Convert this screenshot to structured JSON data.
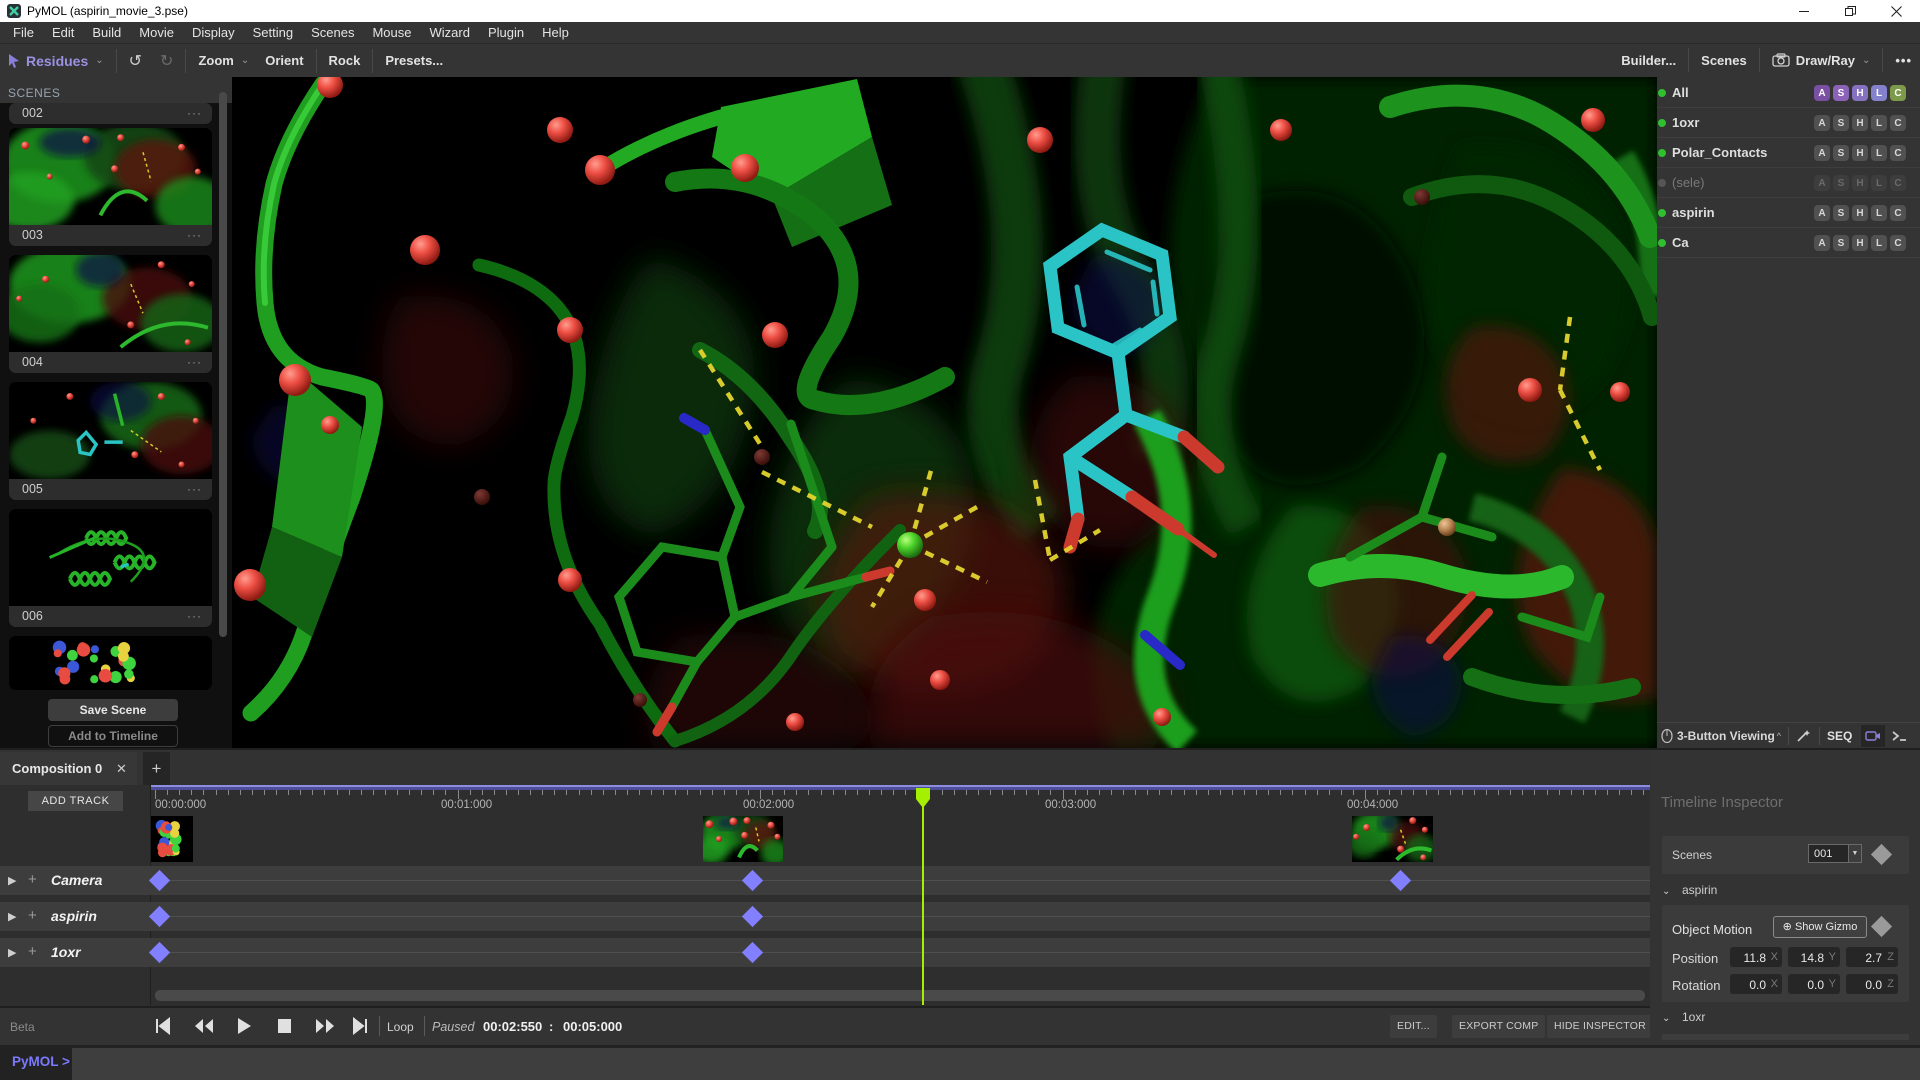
{
  "window": {
    "title": "PyMOL (aspirin_movie_3.pse)"
  },
  "menu": [
    "File",
    "Edit",
    "Build",
    "Movie",
    "Display",
    "Setting",
    "Scenes",
    "Mouse",
    "Wizard",
    "Plugin",
    "Help"
  ],
  "toolbar": {
    "mode": "Residues",
    "undo": "↺",
    "redo": "↻",
    "zoom": "Zoom",
    "orient": "Orient",
    "rock": "Rock",
    "presets": "Presets...",
    "builder": "Builder...",
    "scenes": "Scenes",
    "drawray": "Draw/Ray",
    "more": "•••"
  },
  "scenes_panel": {
    "header": "SCENES",
    "items": [
      {
        "label": "002",
        "more": "···",
        "art": "none"
      },
      {
        "label": "003",
        "more": "···",
        "art": "surf1"
      },
      {
        "label": "004",
        "more": "···",
        "art": "surf2"
      },
      {
        "label": "005",
        "more": "···",
        "art": "cyan"
      },
      {
        "label": "006",
        "more": "···",
        "art": "cartoon"
      }
    ],
    "partial_art": "cpk",
    "save_button": "Save Scene",
    "add_button": "Add to Timeline"
  },
  "objects": {
    "rows": [
      {
        "name": "All",
        "style": "all",
        "buttons": [
          "A",
          "S",
          "H",
          "L",
          "C"
        ]
      },
      {
        "name": "1oxr",
        "style": "normal",
        "buttons": [
          "A",
          "S",
          "H",
          "L",
          "C"
        ]
      },
      {
        "name": "Polar_Contacts",
        "style": "normal",
        "buttons": [
          "A",
          "S",
          "H",
          "L",
          "C"
        ]
      },
      {
        "name": "(sele)",
        "style": "disabled",
        "buttons": [
          "A",
          "S",
          "H",
          "L",
          "C"
        ]
      },
      {
        "name": "aspirin",
        "style": "normal",
        "buttons": [
          "A",
          "S",
          "H",
          "L",
          "C"
        ]
      },
      {
        "name": "Ca",
        "style": "normal",
        "buttons": [
          "A",
          "S",
          "H",
          "L",
          "C"
        ]
      }
    ],
    "all_button_colors": [
      "#7a50a3",
      "#8a62b8",
      "#8671c1",
      "#8482cc",
      "#7d9a4a"
    ]
  },
  "statusbar": {
    "mouse_mode": "3-Button Viewing",
    "seq": "SEQ"
  },
  "timeline": {
    "tab": "Composition 0",
    "tab_close": "✕",
    "tab_plus": "+",
    "add_track": "ADD TRACK",
    "ruler_labels": [
      "00:00:000",
      "00:01:000",
      "00:02:000",
      "00:03:000",
      "00:04:000"
    ],
    "tracks": [
      "Camera",
      "aspirin",
      "1oxr"
    ],
    "loop": "Loop",
    "state": "Paused",
    "current_time": "00:02:550",
    "time_sep": ":",
    "total_time": "00:05:000",
    "beta": "Beta",
    "buttons": [
      "EDIT...",
      "EXPORT COMP",
      "HIDE INSPECTOR"
    ]
  },
  "inspector": {
    "title": "Timeline Inspector",
    "scenes_label": "Scenes",
    "scene_value": "001",
    "section1": "aspirin",
    "section2": "1oxr",
    "object_motion": "Object Motion",
    "show_gizmo": "Show Gizmo",
    "position_label": "Position",
    "rotation_label": "Rotation",
    "position": [
      "11.8",
      "14.8",
      "2.7"
    ],
    "rotation": [
      "0.0",
      "0.0",
      "0.0"
    ],
    "axes": [
      "X",
      "Y",
      "Z"
    ]
  },
  "prompt": {
    "label": "PyMOL >"
  }
}
